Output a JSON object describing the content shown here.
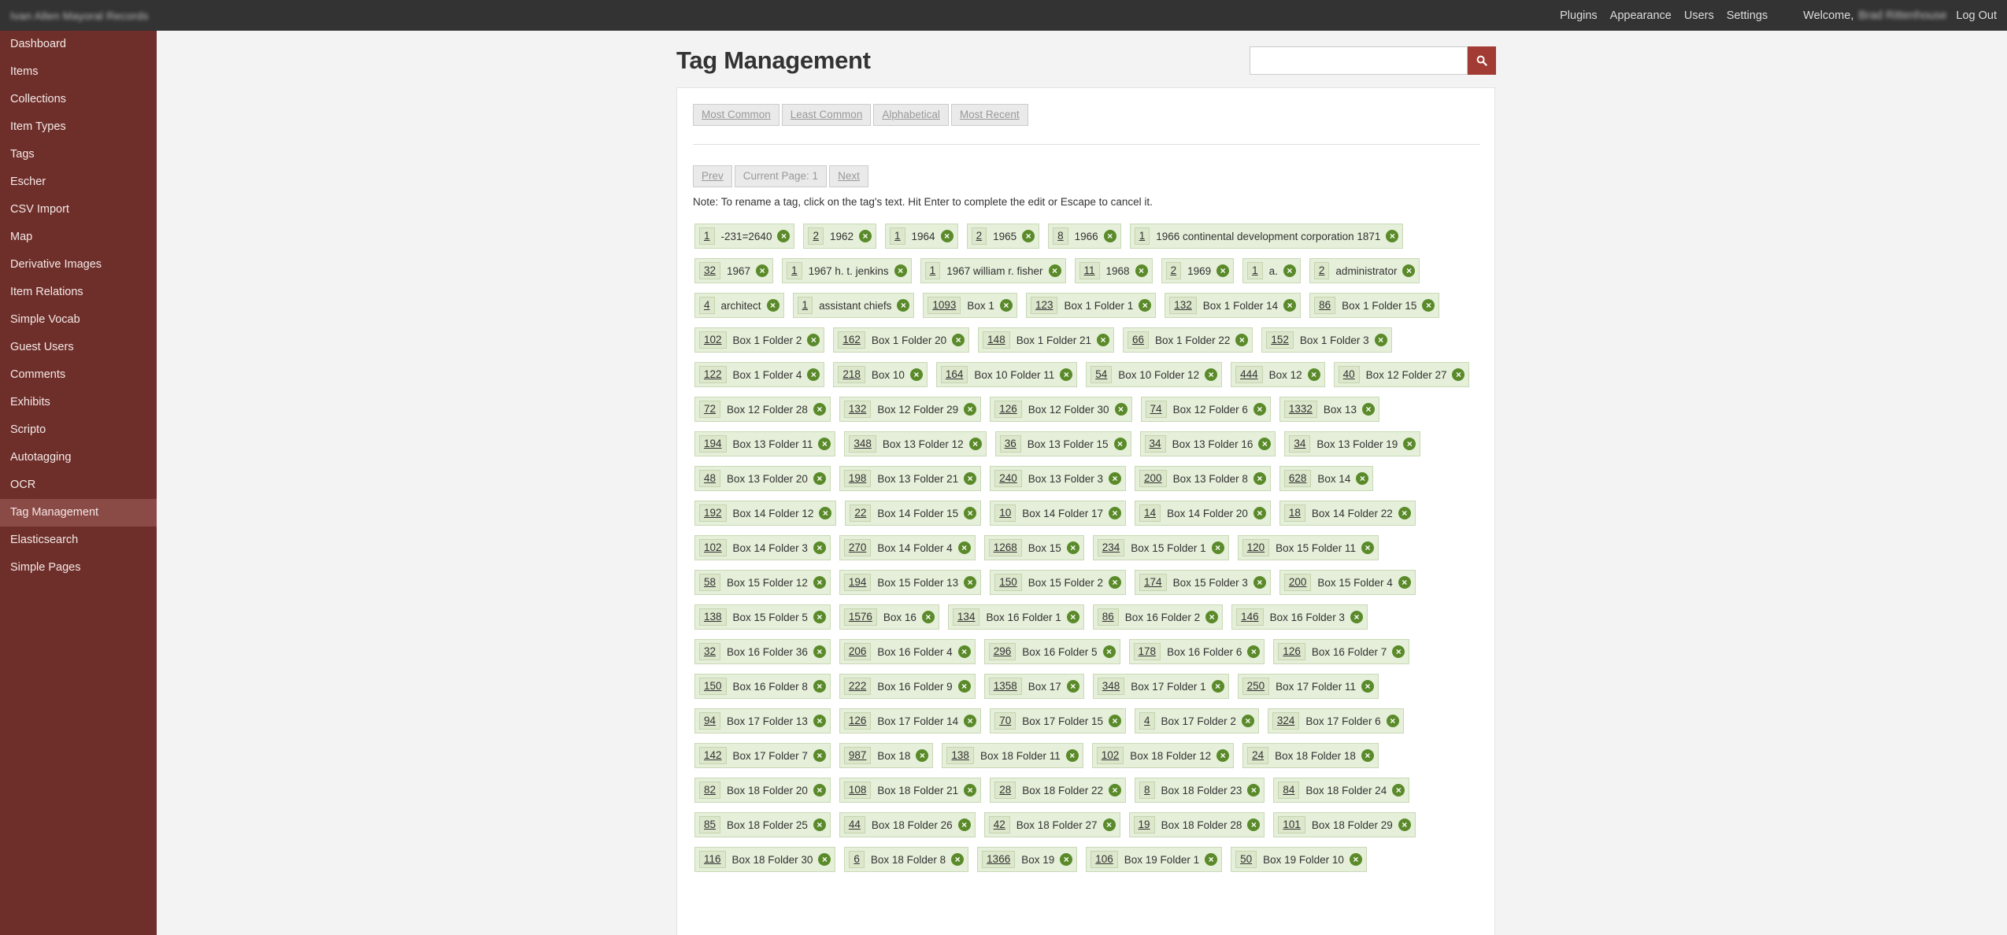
{
  "topbar": {
    "site_title": "Ivan Allen Mayoral Records",
    "nav": [
      "Plugins",
      "Appearance",
      "Users",
      "Settings"
    ],
    "welcome_label": "Welcome,",
    "user_name": "Brad Rittenhouse",
    "logout_label": "Log Out"
  },
  "sidebar": {
    "items": [
      {
        "label": "Dashboard",
        "active": false
      },
      {
        "label": "Items",
        "active": false
      },
      {
        "label": "Collections",
        "active": false
      },
      {
        "label": "Item Types",
        "active": false
      },
      {
        "label": "Tags",
        "active": false
      },
      {
        "label": "Escher",
        "active": false
      },
      {
        "label": "CSV Import",
        "active": false
      },
      {
        "label": "Map",
        "active": false
      },
      {
        "label": "Derivative Images",
        "active": false
      },
      {
        "label": "Item Relations",
        "active": false
      },
      {
        "label": "Simple Vocab",
        "active": false
      },
      {
        "label": "Guest Users",
        "active": false
      },
      {
        "label": "Comments",
        "active": false
      },
      {
        "label": "Exhibits",
        "active": false
      },
      {
        "label": "Scripto",
        "active": false
      },
      {
        "label": "Autotagging",
        "active": false
      },
      {
        "label": "OCR",
        "active": false
      },
      {
        "label": "Tag Management",
        "active": true
      },
      {
        "label": "Elasticsearch",
        "active": false
      },
      {
        "label": "Simple Pages",
        "active": false
      }
    ]
  },
  "main": {
    "title": "Tag Management",
    "search": {
      "value": "",
      "placeholder": ""
    },
    "sort_buttons": [
      "Most Common",
      "Least Common",
      "Alphabetical",
      "Most Recent"
    ],
    "pager": {
      "prev": "Prev",
      "current": "Current Page: 1",
      "next": "Next"
    },
    "note": "Note: To rename a tag, click on the tag's text. Hit Enter to complete the edit or Escape to cancel it.",
    "tags": [
      {
        "count": "1",
        "name": "-231=2640"
      },
      {
        "count": "2",
        "name": "1962"
      },
      {
        "count": "1",
        "name": "1964"
      },
      {
        "count": "2",
        "name": "1965"
      },
      {
        "count": "8",
        "name": "1966"
      },
      {
        "count": "1",
        "name": "1966 continental development corporation 1871"
      },
      {
        "count": "32",
        "name": "1967"
      },
      {
        "count": "1",
        "name": "1967 h. t. jenkins"
      },
      {
        "count": "1",
        "name": "1967 william r. fisher"
      },
      {
        "count": "11",
        "name": "1968"
      },
      {
        "count": "2",
        "name": "1969"
      },
      {
        "count": "1",
        "name": "a."
      },
      {
        "count": "2",
        "name": "administrator"
      },
      {
        "count": "4",
        "name": "architect"
      },
      {
        "count": "1",
        "name": "assistant chiefs"
      },
      {
        "count": "1093",
        "name": "Box 1"
      },
      {
        "count": "123",
        "name": "Box 1 Folder 1"
      },
      {
        "count": "132",
        "name": "Box 1 Folder 14"
      },
      {
        "count": "86",
        "name": "Box 1 Folder 15"
      },
      {
        "count": "102",
        "name": "Box 1 Folder 2"
      },
      {
        "count": "162",
        "name": "Box 1 Folder 20"
      },
      {
        "count": "148",
        "name": "Box 1 Folder 21"
      },
      {
        "count": "66",
        "name": "Box 1 Folder 22"
      },
      {
        "count": "152",
        "name": "Box 1 Folder 3"
      },
      {
        "count": "122",
        "name": "Box 1 Folder 4"
      },
      {
        "count": "218",
        "name": "Box 10"
      },
      {
        "count": "164",
        "name": "Box 10 Folder 11"
      },
      {
        "count": "54",
        "name": "Box 10 Folder 12"
      },
      {
        "count": "444",
        "name": "Box 12"
      },
      {
        "count": "40",
        "name": "Box 12 Folder 27"
      },
      {
        "count": "72",
        "name": "Box 12 Folder 28"
      },
      {
        "count": "132",
        "name": "Box 12 Folder 29"
      },
      {
        "count": "126",
        "name": "Box 12 Folder 30"
      },
      {
        "count": "74",
        "name": "Box 12 Folder 6"
      },
      {
        "count": "1332",
        "name": "Box 13"
      },
      {
        "count": "194",
        "name": "Box 13 Folder 11"
      },
      {
        "count": "348",
        "name": "Box 13 Folder 12"
      },
      {
        "count": "36",
        "name": "Box 13 Folder 15"
      },
      {
        "count": "34",
        "name": "Box 13 Folder 16"
      },
      {
        "count": "34",
        "name": "Box 13 Folder 19"
      },
      {
        "count": "48",
        "name": "Box 13 Folder 20"
      },
      {
        "count": "198",
        "name": "Box 13 Folder 21"
      },
      {
        "count": "240",
        "name": "Box 13 Folder 3"
      },
      {
        "count": "200",
        "name": "Box 13 Folder 8"
      },
      {
        "count": "628",
        "name": "Box 14"
      },
      {
        "count": "192",
        "name": "Box 14 Folder 12"
      },
      {
        "count": "22",
        "name": "Box 14 Folder 15"
      },
      {
        "count": "10",
        "name": "Box 14 Folder 17"
      },
      {
        "count": "14",
        "name": "Box 14 Folder 20"
      },
      {
        "count": "18",
        "name": "Box 14 Folder 22"
      },
      {
        "count": "102",
        "name": "Box 14 Folder 3"
      },
      {
        "count": "270",
        "name": "Box 14 Folder 4"
      },
      {
        "count": "1268",
        "name": "Box 15"
      },
      {
        "count": "234",
        "name": "Box 15 Folder 1"
      },
      {
        "count": "120",
        "name": "Box 15 Folder 11"
      },
      {
        "count": "58",
        "name": "Box 15 Folder 12"
      },
      {
        "count": "194",
        "name": "Box 15 Folder 13"
      },
      {
        "count": "150",
        "name": "Box 15 Folder 2"
      },
      {
        "count": "174",
        "name": "Box 15 Folder 3"
      },
      {
        "count": "200",
        "name": "Box 15 Folder 4"
      },
      {
        "count": "138",
        "name": "Box 15 Folder 5"
      },
      {
        "count": "1576",
        "name": "Box 16"
      },
      {
        "count": "134",
        "name": "Box 16 Folder 1"
      },
      {
        "count": "86",
        "name": "Box 16 Folder 2"
      },
      {
        "count": "146",
        "name": "Box 16 Folder 3"
      },
      {
        "count": "32",
        "name": "Box 16 Folder 36"
      },
      {
        "count": "206",
        "name": "Box 16 Folder 4"
      },
      {
        "count": "296",
        "name": "Box 16 Folder 5"
      },
      {
        "count": "178",
        "name": "Box 16 Folder 6"
      },
      {
        "count": "126",
        "name": "Box 16 Folder 7"
      },
      {
        "count": "150",
        "name": "Box 16 Folder 8"
      },
      {
        "count": "222",
        "name": "Box 16 Folder 9"
      },
      {
        "count": "1358",
        "name": "Box 17"
      },
      {
        "count": "348",
        "name": "Box 17 Folder 1"
      },
      {
        "count": "250",
        "name": "Box 17 Folder 11"
      },
      {
        "count": "94",
        "name": "Box 17 Folder 13"
      },
      {
        "count": "126",
        "name": "Box 17 Folder 14"
      },
      {
        "count": "70",
        "name": "Box 17 Folder 15"
      },
      {
        "count": "4",
        "name": "Box 17 Folder 2"
      },
      {
        "count": "324",
        "name": "Box 17 Folder 6"
      },
      {
        "count": "142",
        "name": "Box 17 Folder 7"
      },
      {
        "count": "987",
        "name": "Box 18"
      },
      {
        "count": "138",
        "name": "Box 18 Folder 11"
      },
      {
        "count": "102",
        "name": "Box 18 Folder 12"
      },
      {
        "count": "24",
        "name": "Box 18 Folder 18"
      },
      {
        "count": "82",
        "name": "Box 18 Folder 20"
      },
      {
        "count": "108",
        "name": "Box 18 Folder 21"
      },
      {
        "count": "28",
        "name": "Box 18 Folder 22"
      },
      {
        "count": "8",
        "name": "Box 18 Folder 23"
      },
      {
        "count": "84",
        "name": "Box 18 Folder 24"
      },
      {
        "count": "85",
        "name": "Box 18 Folder 25"
      },
      {
        "count": "44",
        "name": "Box 18 Folder 26"
      },
      {
        "count": "42",
        "name": "Box 18 Folder 27"
      },
      {
        "count": "19",
        "name": "Box 18 Folder 28"
      },
      {
        "count": "101",
        "name": "Box 18 Folder 29"
      },
      {
        "count": "116",
        "name": "Box 18 Folder 30"
      },
      {
        "count": "6",
        "name": "Box 18 Folder 8"
      },
      {
        "count": "1366",
        "name": "Box 19"
      },
      {
        "count": "106",
        "name": "Box 19 Folder 1"
      },
      {
        "count": "50",
        "name": "Box 19 Folder 10"
      }
    ]
  }
}
